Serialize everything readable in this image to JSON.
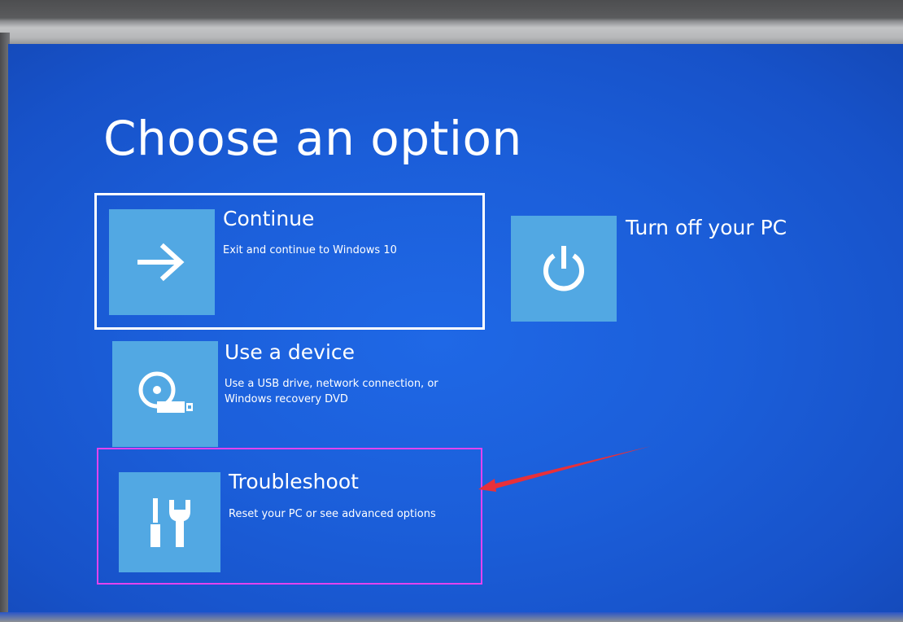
{
  "page": {
    "title": "Choose an option"
  },
  "options": [
    {
      "id": "continue",
      "title": "Continue",
      "description": "Exit and continue to Windows 10",
      "icon": "arrow-right-icon",
      "selected": true
    },
    {
      "id": "use-device",
      "title": "Use a device",
      "description_lines": [
        "Use a USB drive, network connection, or",
        "Windows recovery DVD"
      ],
      "icon": "disc-usb-icon"
    },
    {
      "id": "troubleshoot",
      "title": "Troubleshoot",
      "description": "Reset your PC or see advanced options",
      "icon": "tools-icon",
      "highlighted": true
    },
    {
      "id": "turn-off",
      "title": "Turn off your PC",
      "icon": "power-icon"
    }
  ],
  "colors": {
    "background": "#1b5ed9",
    "tile": "#52a8e3",
    "text": "#ffffff",
    "annotation_box": "#e243ef",
    "annotation_arrow": "#e8303a"
  }
}
